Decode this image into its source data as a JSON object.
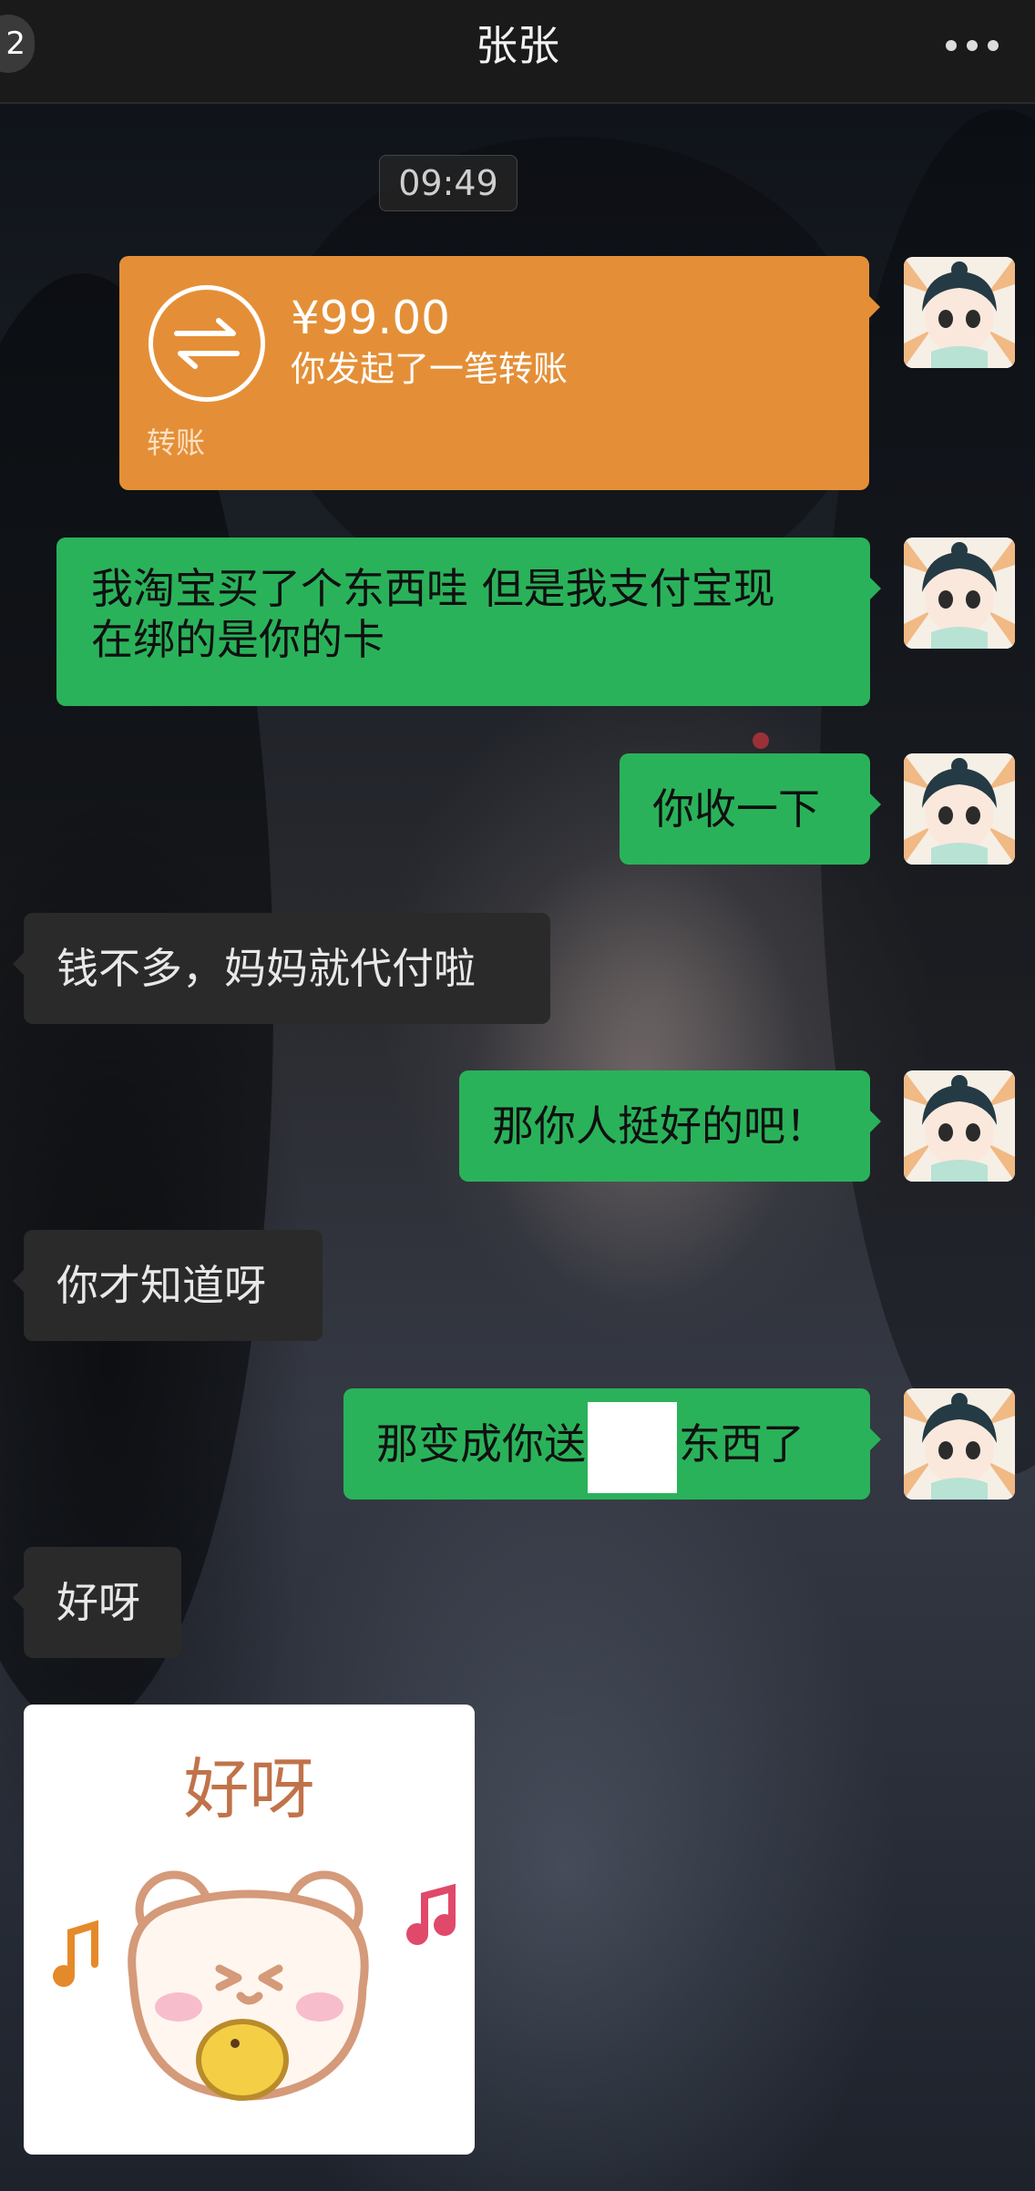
{
  "header": {
    "unread_count": "2",
    "title": "张张",
    "more_icon": "more-dots-icon"
  },
  "timestamp": "09:49",
  "transfer": {
    "amount": "¥99.00",
    "description": "你发起了一笔转账",
    "label": "转账",
    "icon": "transfer-arrows-icon",
    "color": "#e48f37"
  },
  "messages": [
    {
      "side": "right",
      "text_line1": "我淘宝买了个东西哇 但是我支付宝现",
      "text_line2": "在绑的是你的卡"
    },
    {
      "side": "right",
      "text": "你收一下"
    },
    {
      "side": "left",
      "text": "钱不多，妈妈就代付啦"
    },
    {
      "side": "right",
      "text": "那你人挺好的吧！"
    },
    {
      "side": "left",
      "text": "你才知道呀"
    },
    {
      "side": "right",
      "text_before": "那变成你送",
      "text_after": "东西了"
    },
    {
      "side": "left",
      "text": "好呀"
    }
  ],
  "sticker": {
    "caption": "好呀",
    "icon": "bear-sticker-icon"
  },
  "colors": {
    "sent_bubble": "#2ab25a",
    "received_bubble": "#2a2a2a",
    "top_bar": "#1a1a1a"
  }
}
